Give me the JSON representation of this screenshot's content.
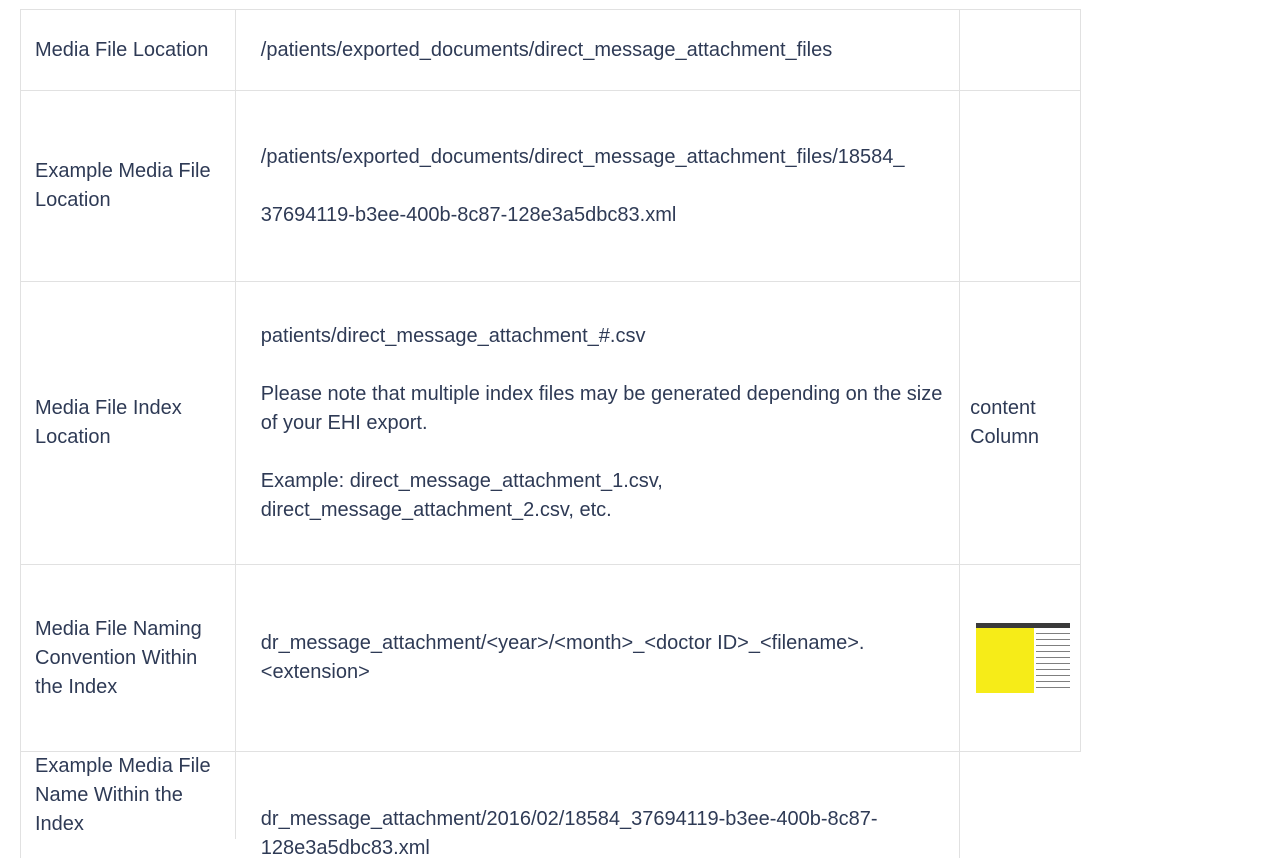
{
  "rows": [
    {
      "label": "Media File Location",
      "value": "/patients/exported_documents/direct_message_attachment_files",
      "third": ""
    },
    {
      "label": "Example Media File Location",
      "value_line1": "/patients/exported_documents/direct_message_attachment_files/18584_",
      "value_line2": "37694119-b3ee-400b-8c87-128e3a5dbc83.xml",
      "third": ""
    },
    {
      "label": "Media File Index Location",
      "value_p1": "patients/direct_message_attachment_#.csv",
      "value_p2": "Please note that multiple index files may be generated depending on the size of your EHI export.",
      "value_p3": "Example: direct_message_attachment_1.csv, direct_message_attachment_2.csv, etc.",
      "third": "content Column"
    },
    {
      "label": "Media File Naming Convention Within the Index",
      "value": "dr_message_attachment/<year>/<month>_<doctor ID>_<filename>.<extension>",
      "third_image": "spreadsheet-thumbnail"
    },
    {
      "label": "Example Media File Name Within the Index",
      "value": "dr_message_attachment/2016/02/18584_37694119-b3ee-400b-8c87-128e3a5dbc83.xml",
      "third": ""
    }
  ]
}
